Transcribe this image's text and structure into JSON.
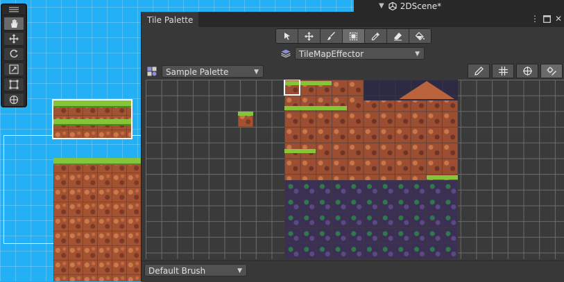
{
  "hierarchy": {
    "scene_name": "2DScene*"
  },
  "scene_tools": [
    "hand-tool",
    "move-tool",
    "rotate-tool",
    "scale-tool",
    "rect-tool",
    "transform-tool"
  ],
  "tile_palette": {
    "tab_title": "Tile Palette",
    "tools": [
      "select",
      "move",
      "paint",
      "box-fill",
      "picker",
      "erase",
      "fill"
    ],
    "active_tool": "box-fill",
    "active_target": "TileMapEffector",
    "palette_name": "Sample Palette",
    "brush": "Default Brush"
  },
  "colors": {
    "scene_background": "#23b0f4",
    "window_background": "#383838",
    "grass": "#86c43a",
    "dirt": "#a35232"
  }
}
